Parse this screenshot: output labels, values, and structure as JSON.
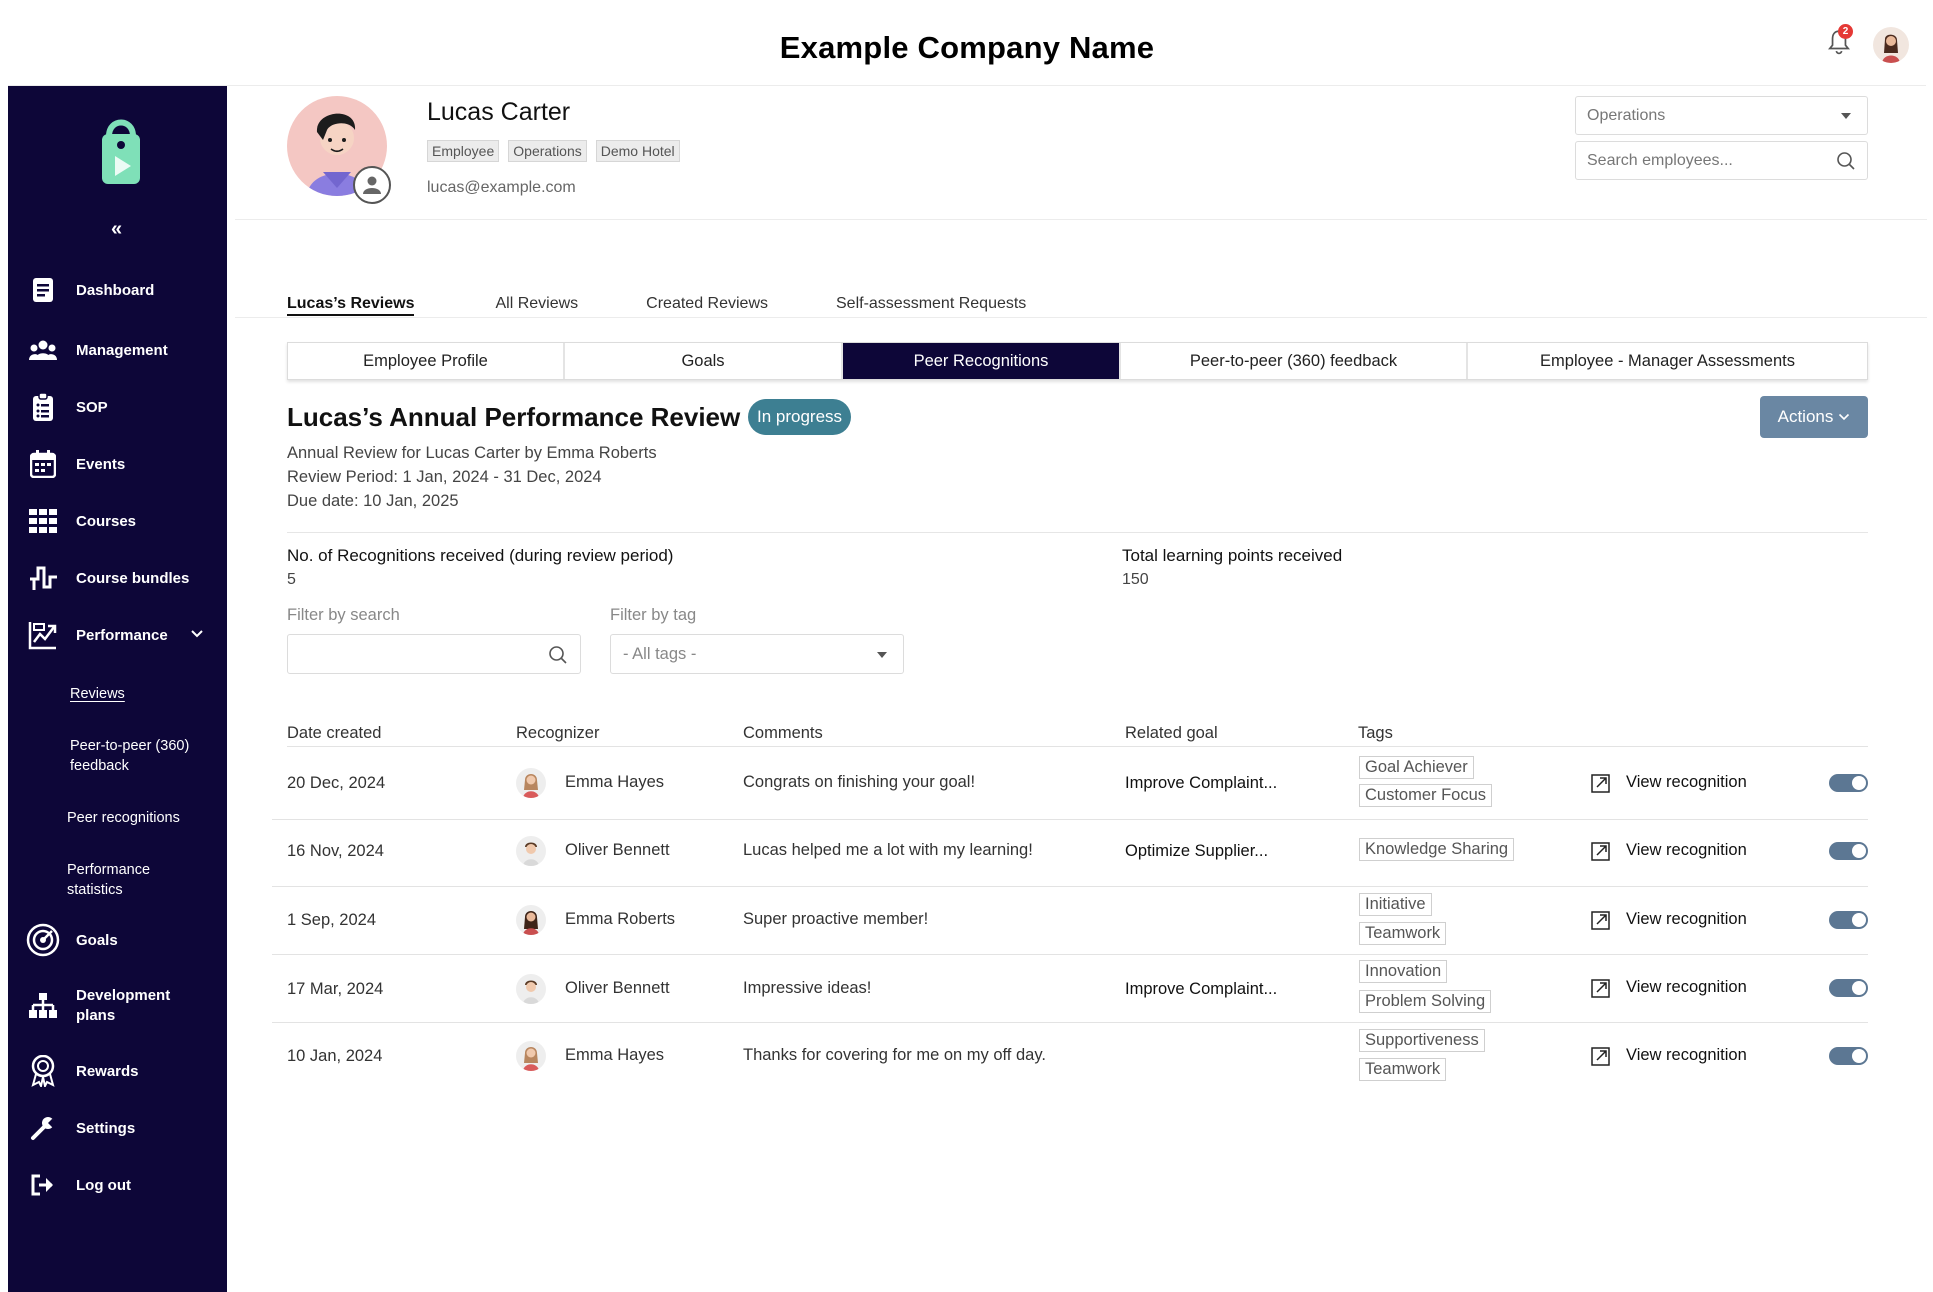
{
  "header": {
    "company_name": "Example Company Name",
    "notification_count": "2"
  },
  "sidebar": {
    "collapse_label": "«",
    "items": [
      {
        "label": "Dashboard",
        "icon": "dashboard-icon"
      },
      {
        "label": "Management",
        "icon": "people-icon"
      },
      {
        "label": "SOP",
        "icon": "clipboard-icon"
      },
      {
        "label": "Events",
        "icon": "calendar-icon"
      },
      {
        "label": "Courses",
        "icon": "grid-icon"
      },
      {
        "label": "Course bundles",
        "icon": "bundle-icon"
      },
      {
        "label": "Performance",
        "icon": "chart-icon"
      },
      {
        "label": "Goals",
        "icon": "target-icon"
      },
      {
        "label": "Development plans",
        "icon": "hierarchy-icon"
      },
      {
        "label": "Rewards",
        "icon": "award-icon"
      },
      {
        "label": "Settings",
        "icon": "wrench-icon"
      },
      {
        "label": "Log out",
        "icon": "logout-icon"
      }
    ],
    "performance_sub": [
      {
        "label": "Reviews"
      },
      {
        "label": "Peer-to-peer (360) feedback"
      },
      {
        "label": "Peer recognitions"
      },
      {
        "label": "Performance statistics"
      }
    ]
  },
  "profile": {
    "name": "Lucas Carter",
    "tags": [
      "Employee",
      "Operations",
      "Demo Hotel"
    ],
    "email": "lucas@example.com",
    "department_select": "Operations",
    "search_placeholder": "Search employees..."
  },
  "review_tabs": [
    "Lucas’s Reviews",
    "All Reviews",
    "Created Reviews",
    "Self-assessment Requests"
  ],
  "section_tabs": [
    "Employee Profile",
    "Goals",
    "Peer Recognitions",
    "Peer-to-peer (360) feedback",
    "Employee - Manager Assessments"
  ],
  "review": {
    "title": "Lucas’s Annual Performance Review",
    "status": "In progress",
    "actions_label": "Actions",
    "description": "Annual Review for Lucas Carter by Emma Roberts",
    "period": "Review Period: 1 Jan, 2024 - 31 Dec, 2024",
    "due": "Due date: 10 Jan, 2025"
  },
  "stats": {
    "recognitions_label": "No. of Recognitions received (during review period)",
    "recognitions_value": "5",
    "points_label": "Total learning points received",
    "points_value": "150"
  },
  "filters": {
    "search_label": "Filter by search",
    "tag_label": "Filter by tag",
    "tag_value": "- All tags -"
  },
  "table": {
    "columns": [
      "Date created",
      "Recognizer",
      "Comments",
      "Related goal",
      "Tags"
    ],
    "view_label": "View recognition",
    "rows": [
      {
        "date": "20 Dec, 2024",
        "recognizer": "Emma Hayes",
        "comment": "Congrats on finishing your goal!",
        "goal": "Improve Complaint...",
        "tags": [
          "Goal Achiever",
          "Customer Focus"
        ],
        "enabled": true
      },
      {
        "date": "16 Nov, 2024",
        "recognizer": "Oliver Bennett",
        "comment": "Lucas helped me a lot with my learning!",
        "goal": "Optimize Supplier...",
        "tags": [
          "Knowledge Sharing"
        ],
        "enabled": true
      },
      {
        "date": "1 Sep, 2024",
        "recognizer": "Emma Roberts",
        "comment": "Super proactive member!",
        "goal": "",
        "tags": [
          "Initiative",
          "Teamwork"
        ],
        "enabled": true
      },
      {
        "date": "17 Mar, 2024",
        "recognizer": "Oliver Bennett",
        "comment": "Impressive ideas!",
        "goal": "Improve Complaint...",
        "tags": [
          "Innovation",
          "Problem Solving"
        ],
        "enabled": true
      },
      {
        "date": "10 Jan, 2024",
        "recognizer": "Emma Hayes",
        "comment": "Thanks for covering for me on my off day.",
        "goal": "",
        "tags": [
          "Supportiveness",
          "Teamwork"
        ],
        "enabled": true
      }
    ]
  },
  "colors": {
    "sidebar": "#0d0638",
    "status_badge": "#3d7f92",
    "actions_button": "#6a87a3",
    "toggle": "#5c7793"
  }
}
